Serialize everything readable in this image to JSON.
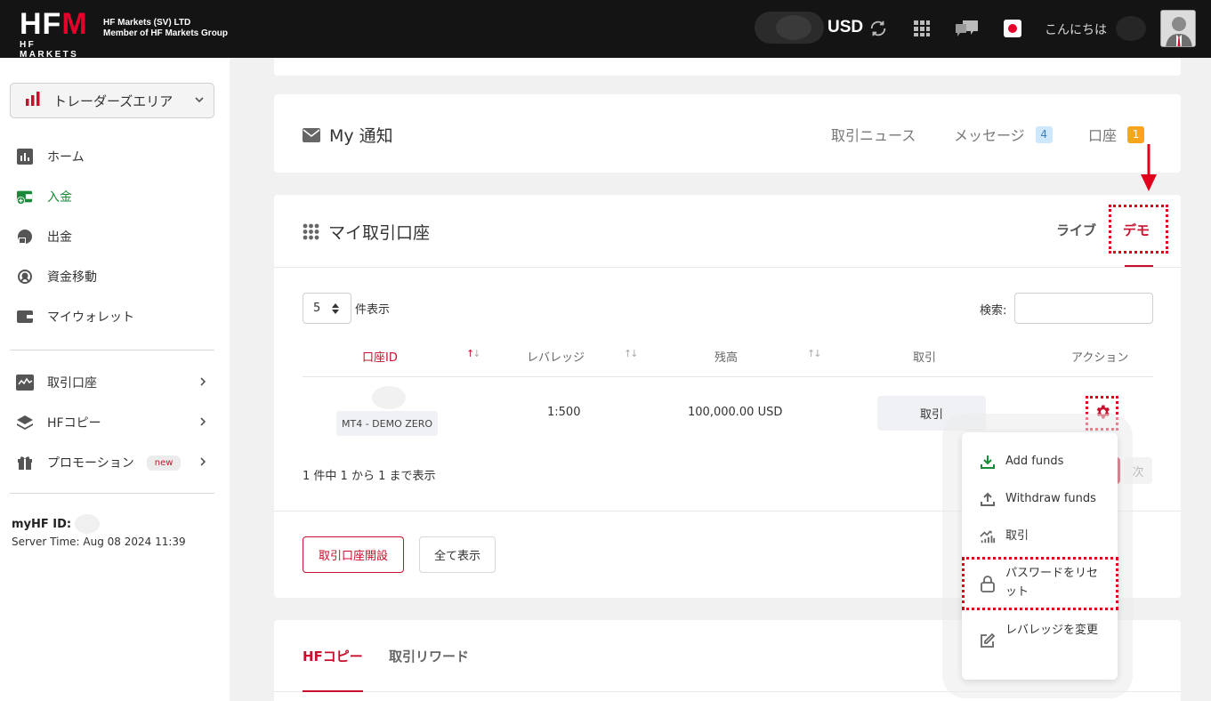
{
  "header": {
    "logo_text": "HFM",
    "logo_sub": "HF MARKETS",
    "company_line1": "HF Markets (SV) LTD",
    "company_line2": "Member of HF Markets Group",
    "currency": "USD",
    "greeting": "こんにちは"
  },
  "sidebar": {
    "area_label": "トレーダーズエリア",
    "items": [
      {
        "label": "ホーム",
        "icon": "chart-icon"
      },
      {
        "label": "入金",
        "icon": "deposit-wallet-icon"
      },
      {
        "label": "出金",
        "icon": "withdraw-icon"
      },
      {
        "label": "資金移動",
        "icon": "transfer-icon"
      },
      {
        "label": "マイウォレット",
        "icon": "wallet-icon"
      }
    ],
    "items2": [
      {
        "label": "取引口座",
        "icon": "trading-account-icon"
      },
      {
        "label": "HFコピー",
        "icon": "layers-icon"
      },
      {
        "label": "プロモーション",
        "icon": "gift-icon",
        "badge": "new"
      }
    ],
    "myhf_label": "myHF ID:",
    "server_time": "Server Time: Aug 08 2024 11:39"
  },
  "notifications": {
    "title": "My 通知",
    "links": [
      {
        "label": "取引ニュース"
      },
      {
        "label": "メッセージ",
        "count": "4"
      },
      {
        "label": "口座",
        "count": "1"
      }
    ]
  },
  "accounts": {
    "title": "マイ取引口座",
    "tab_live": "ライブ",
    "tab_demo": "デモ",
    "length_value": "5",
    "length_label": "件表示",
    "search_label": "検索:",
    "columns": [
      "口座ID",
      "レバレッジ",
      "残高",
      "取引",
      "アクション"
    ],
    "rows": [
      {
        "account_type": "MT4 - DEMO ZERO",
        "leverage": "1:500",
        "balance": "100,000.00 USD",
        "trade_label": "取引"
      }
    ],
    "info": "1 件中 1 から 1 まで表示",
    "next_label": "次",
    "btn_open": "取引口座開設",
    "btn_all": "全て表示"
  },
  "action_menu": {
    "items": [
      {
        "label": "Add funds",
        "icon": "download-icon"
      },
      {
        "label": "Withdraw funds",
        "icon": "upload-icon"
      },
      {
        "label": "取引",
        "icon": "trade-chart-icon"
      },
      {
        "label": "パスワードをリセット",
        "icon": "lock-icon"
      },
      {
        "label": "レバレッジを変更",
        "icon": "edit-icon"
      }
    ]
  },
  "copy_section": {
    "tab1": "HFコピー",
    "tab2": "取引リワード"
  },
  "colors": {
    "brand_red": "#c8102e",
    "active_green": "#198a3a",
    "annotation_red": "#e0001b"
  }
}
